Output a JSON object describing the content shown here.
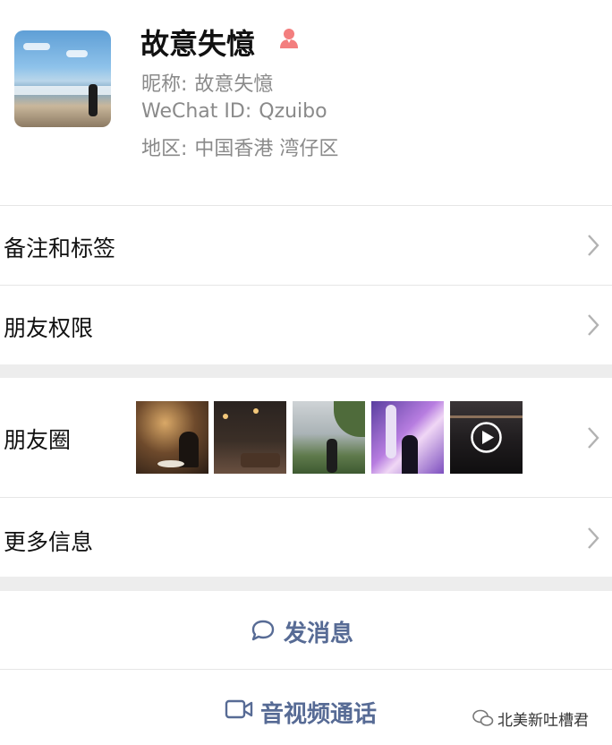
{
  "profile": {
    "name": "故意失憶",
    "nickname_label": "昵称:",
    "nickname": "故意失憶",
    "wechat_id_label": "WeChat ID:",
    "wechat_id": "Qzuibo",
    "region_label": "地区:",
    "region": "中国香港 湾仔区",
    "gender_icon": "female-icon"
  },
  "menu": {
    "remarks_tags": "备注和标签",
    "friend_permissions": "朋友权限",
    "moments": "朋友圈",
    "more_info": "更多信息"
  },
  "actions": {
    "send_message": "发消息",
    "av_call": "音视频通话"
  },
  "watermark": "北美新吐槽君",
  "colors": {
    "link_blue": "#576b95",
    "secondary_text": "#8a8a8a",
    "female_pink": "#f37e7e",
    "separator": "#ededed"
  }
}
